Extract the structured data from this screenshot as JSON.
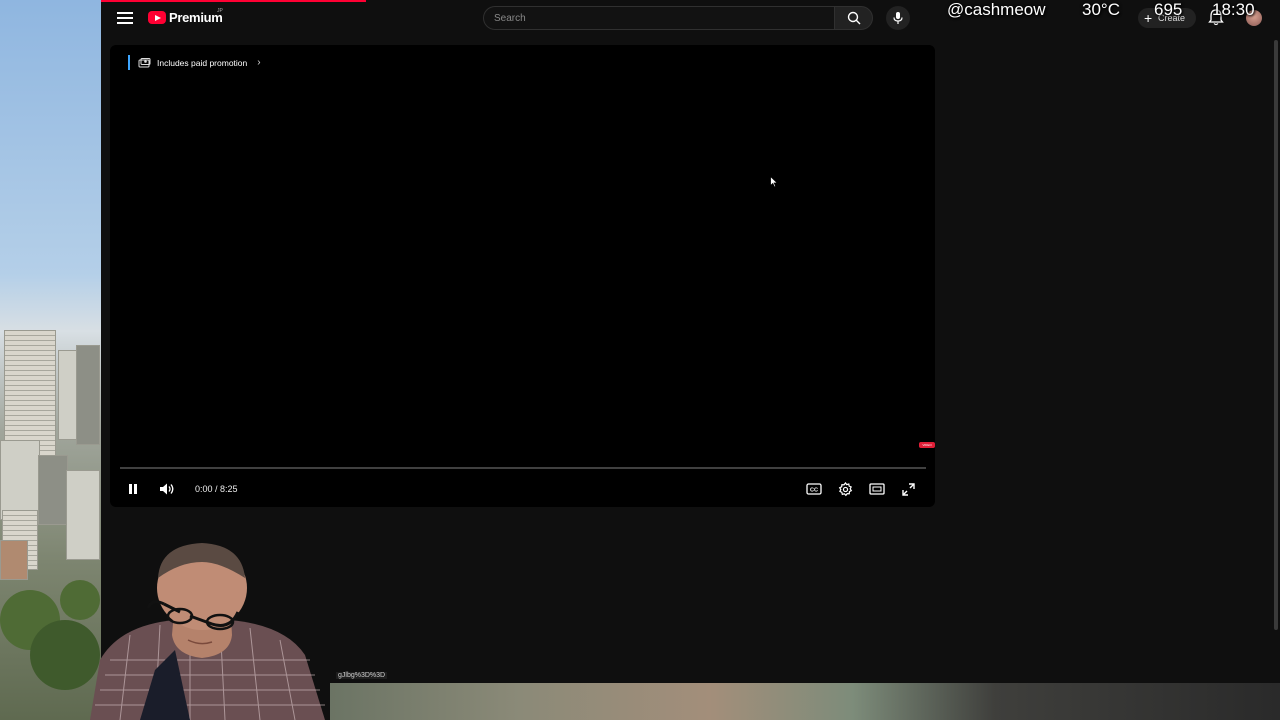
{
  "topbar": {
    "logo_text": "Premium",
    "region": "JP",
    "search_placeholder": "Search",
    "create_label": "Create"
  },
  "overlay": {
    "handle": "@cashmeow",
    "temperature": "30°C",
    "count": "695",
    "clock": "18:30"
  },
  "player": {
    "paid_promotion": "Includes paid promotion",
    "time_display": "0:00 / 8:25",
    "badge": "VIDEO",
    "progress": 0
  },
  "status_url": "gJlbg%3D%3D",
  "colors": {
    "brand_red": "#ff0033",
    "background": "#0f0f0f",
    "accent_blue": "#3ea6ff"
  }
}
